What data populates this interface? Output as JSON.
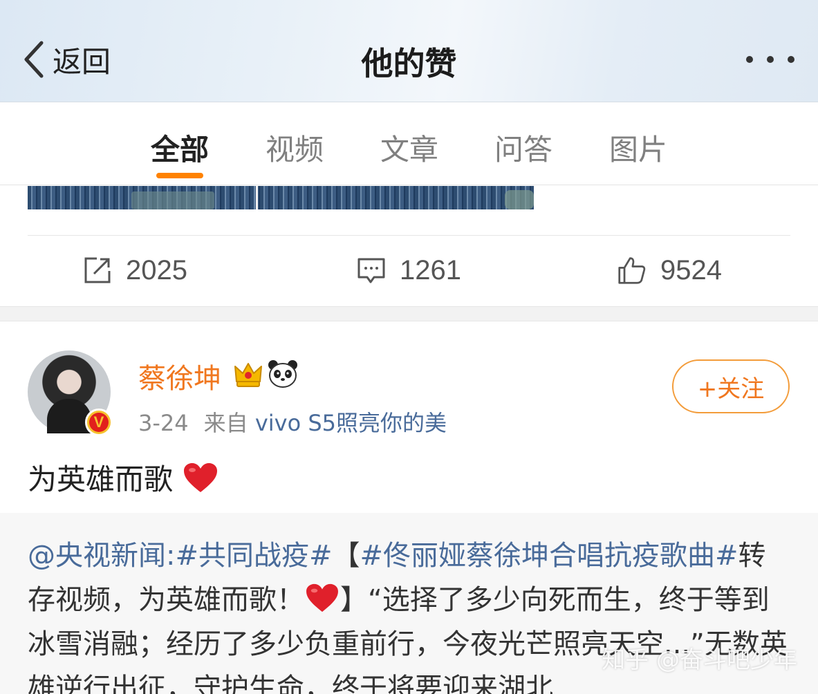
{
  "header": {
    "back_label": "返回",
    "title": "他的赞"
  },
  "tabs": [
    {
      "label": "全部",
      "active": true
    },
    {
      "label": "视频",
      "active": false
    },
    {
      "label": "文章",
      "active": false
    },
    {
      "label": "问答",
      "active": false
    },
    {
      "label": "图片",
      "active": false
    }
  ],
  "previous_post": {
    "actions": {
      "repost_count": "2025",
      "comment_count": "1261",
      "like_count": "9524"
    }
  },
  "post": {
    "username": "蔡徐坤",
    "time": "3-24",
    "source_prefix": "来自",
    "source": "vivo S5照亮你的美",
    "follow_label": "+关注",
    "text": "为英雄而歌",
    "repost": {
      "mention": "@央视新闻",
      "colon": ":",
      "hashtag1": "#共同战疫#",
      "bracket_open": "【",
      "hashtag2": "#佟丽娅蔡徐坤合唱抗疫歌曲#",
      "line1_rest": "转存视频，为英雄而歌！",
      "line1_after": "】“选择了多少向死而生，终于等到冰雪消融；经历了多少负重前行，今夜光芒照亮天空...”无数英雄逆行出征，守护生命，终于将要迎来湖北"
    }
  },
  "watermark": "知乎 @奋斗吧少年",
  "colors": {
    "accent": "#ff8200",
    "username": "#f0771f",
    "link": "#496b9a",
    "heart": "#e0202b"
  },
  "icons": [
    "back-chevron-icon",
    "more-dots-icon",
    "repost-icon",
    "comment-icon",
    "like-icon",
    "crown-icon",
    "panda-icon",
    "verified-icon",
    "heart-icon"
  ]
}
